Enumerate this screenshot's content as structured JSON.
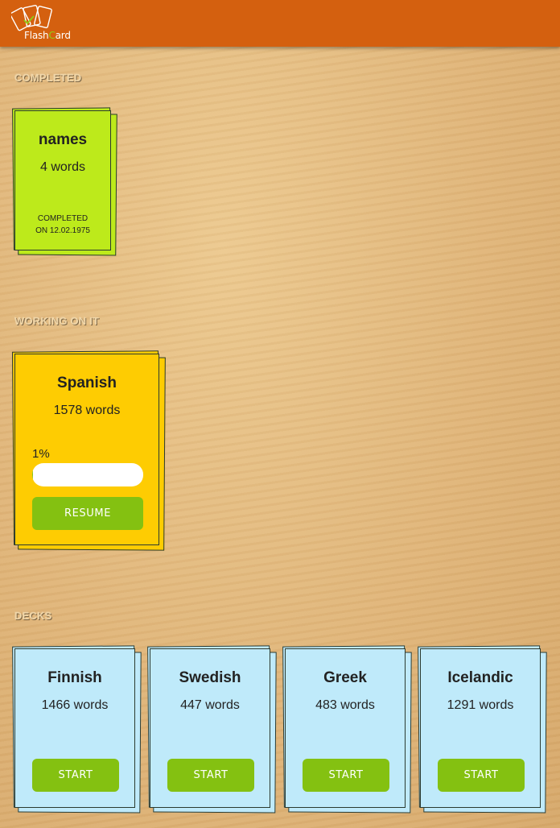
{
  "app": {
    "logo_text_a": "Flash",
    "logo_text_c": "C",
    "logo_text_b": "ard",
    "header_color": "#d4600f"
  },
  "sections": {
    "completed": "COMPLETED",
    "working": "WORKING ON IT",
    "decks": "DECKS"
  },
  "completed_card": {
    "title": "names",
    "count": "4 words",
    "status_line1": "COMPLETED",
    "status_line2": "ON 12.02.1975",
    "color": "#bdea1b"
  },
  "working_card": {
    "title": "Spanish",
    "count": "1578 words",
    "progress_label": "1%",
    "progress_value": 0.01,
    "button": "RESUME",
    "color": "#fecc02"
  },
  "decks": [
    {
      "title": "Finnish",
      "count": "1466 words",
      "button": "START"
    },
    {
      "title": "Swedish",
      "count": "447 words",
      "button": "START"
    },
    {
      "title": "Greek",
      "count": "483 words",
      "button": "START"
    },
    {
      "title": "Icelandic",
      "count": "1291 words",
      "button": "START"
    }
  ],
  "colors": {
    "deck_card": "#bfeafa",
    "button": "#84c111"
  }
}
